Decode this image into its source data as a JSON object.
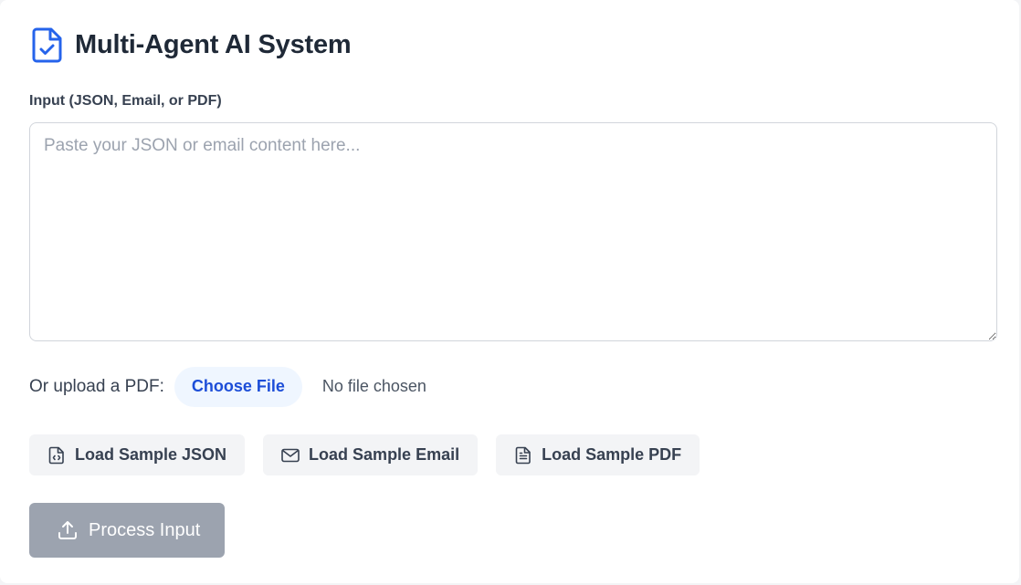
{
  "header": {
    "title": "Multi-Agent AI System",
    "icon": "file-check-icon",
    "accent_color": "#2563eb"
  },
  "input": {
    "label": "Input (JSON, Email, or PDF)",
    "placeholder": "Paste your JSON or email content here...",
    "value": ""
  },
  "upload": {
    "label": "Or upload a PDF:",
    "button_label": "Choose File",
    "status": "No file chosen"
  },
  "samples": [
    {
      "label": "Load Sample JSON",
      "icon": "file-code-icon"
    },
    {
      "label": "Load Sample Email",
      "icon": "mail-icon"
    },
    {
      "label": "Load Sample PDF",
      "icon": "file-text-icon"
    }
  ],
  "process": {
    "label": "Process Input",
    "icon": "upload-icon",
    "disabled": true
  }
}
